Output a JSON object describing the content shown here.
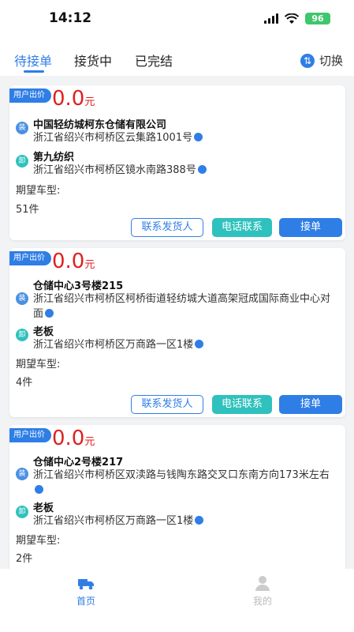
{
  "status": {
    "time": "14:12",
    "battery": "96"
  },
  "tabs": {
    "pending": "待接单",
    "receiving": "接货中",
    "done": "已完结",
    "switch": "切换"
  },
  "common": {
    "price_tag": "用户出价",
    "currency": "元",
    "load_icon": "装",
    "unload_icon": "卸",
    "car_type_label": "期望车型:",
    "contact_shipper": "联系发货人",
    "phone_contact": "电话联系",
    "accept": "接单"
  },
  "orders": [
    {
      "price": "0.0",
      "load_name": "中国轻纺城柯东仓储有限公司",
      "load_addr": "浙江省绍兴市柯桥区云集路1001号",
      "unload_name": "第九纺织",
      "unload_addr": "浙江省绍兴市柯桥区镜水南路388号",
      "qty": "51件"
    },
    {
      "price": "0.0",
      "load_name": "仓储中心3号楼215",
      "load_addr": "浙江省绍兴市柯桥区柯桥街道轻纺城大道高架冠成国际商业中心对面",
      "unload_name": "老板",
      "unload_addr": "浙江省绍兴市柯桥区万商路一区1楼",
      "qty": "4件"
    },
    {
      "price": "0.0",
      "load_name": "仓储中心2号楼217",
      "load_addr": "浙江省绍兴市柯桥区双渎路与钱陶东路交叉口东南方向173米左右",
      "unload_name": "老板",
      "unload_addr": "浙江省绍兴市柯桥区万商路一区1楼",
      "qty": "2件"
    }
  ],
  "bottom_nav": {
    "home": "首页",
    "mine": "我的"
  },
  "colors": {
    "accent": "#2f7ee6",
    "price": "#e02020",
    "teal": "#2fc1bd"
  }
}
